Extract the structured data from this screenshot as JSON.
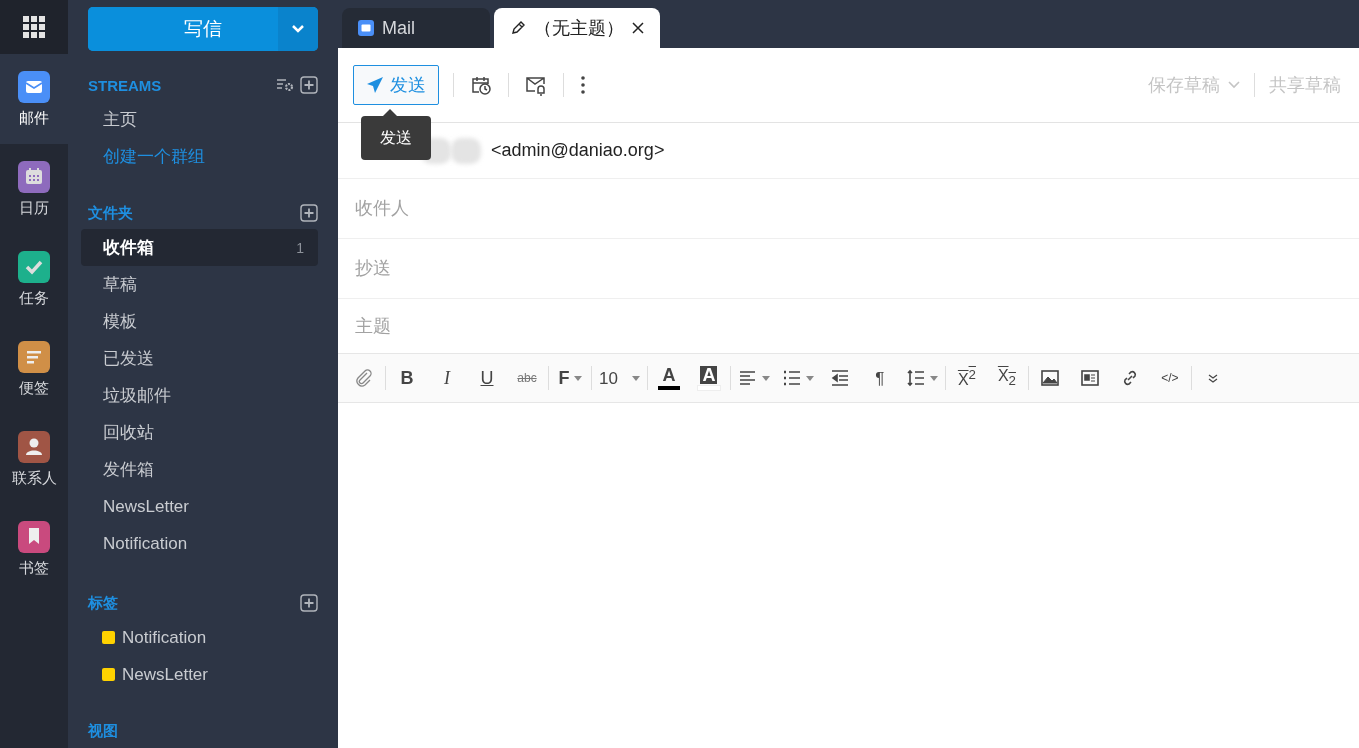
{
  "app_rail": {
    "items": [
      {
        "kind": "mail",
        "label": "邮件",
        "color": "#4a8ff7",
        "selected": true
      },
      {
        "kind": "calendar",
        "label": "日历",
        "color": "#8e6bbd",
        "selected": false
      },
      {
        "kind": "tasks",
        "label": "任务",
        "color": "#1db08c",
        "selected": false
      },
      {
        "kind": "notes",
        "label": "便签",
        "color": "#d08f47",
        "selected": false
      },
      {
        "kind": "contacts",
        "label": "联系人",
        "color": "#a05545",
        "selected": false
      },
      {
        "kind": "bookmarks",
        "label": "书签",
        "color": "#c94a7e",
        "selected": false
      }
    ]
  },
  "compose_button": {
    "label": "写信"
  },
  "streams": {
    "title": "STREAMS",
    "items": [
      {
        "label": "主页",
        "kind": "plain"
      },
      {
        "label": "创建一个群组",
        "kind": "link"
      }
    ]
  },
  "folders": {
    "title": "文件夹",
    "items": [
      {
        "label": "收件箱",
        "selected": true,
        "count": "1"
      },
      {
        "label": "草稿",
        "selected": false
      },
      {
        "label": "模板",
        "selected": false
      },
      {
        "label": "已发送",
        "selected": false
      },
      {
        "label": "垃圾邮件",
        "selected": false
      },
      {
        "label": "回收站",
        "selected": false
      },
      {
        "label": "发件箱",
        "selected": false
      },
      {
        "label": "NewsLetter",
        "selected": false
      },
      {
        "label": "Notification",
        "selected": false
      }
    ]
  },
  "tags": {
    "title": "标签",
    "items": [
      {
        "label": "Notification",
        "color": "#ffd200"
      },
      {
        "label": "NewsLetter",
        "color": "#ffd200"
      }
    ]
  },
  "views": {
    "title": "视图"
  },
  "tabs": [
    {
      "kind": "mail",
      "label": "Mail",
      "selected": false
    },
    {
      "kind": "draft",
      "label": "（无主题）",
      "selected": true
    }
  ],
  "compose_toolbar": {
    "send": "发送",
    "tooltip": "发送",
    "save_draft": "保存草稿",
    "share_draft": "共享草稿"
  },
  "fields": {
    "from": "<admin@daniao.org>",
    "to": {
      "placeholder": "收件人"
    },
    "cc": {
      "placeholder": "抄送"
    },
    "subject": {
      "placeholder": "主题"
    }
  },
  "editor_toolbar": {
    "groups": [
      [
        {
          "kind": "attach"
        }
      ],
      [
        {
          "kind": "bold",
          "text": "B"
        },
        {
          "kind": "italic",
          "text": "I"
        },
        {
          "kind": "underline",
          "text": "U"
        },
        {
          "kind": "strike",
          "text": "abc"
        }
      ],
      [
        {
          "kind": "font",
          "text": "F"
        }
      ],
      [
        {
          "kind": "size",
          "text": "10"
        }
      ],
      [
        {
          "kind": "text-color",
          "text": "A",
          "color": "#000000"
        },
        {
          "kind": "highlight",
          "text": "A",
          "color": "#ffffff"
        }
      ],
      [
        {
          "kind": "align"
        },
        {
          "kind": "list"
        },
        {
          "kind": "outdent"
        },
        {
          "kind": "paragraph",
          "text": "¶"
        },
        {
          "kind": "line-height"
        }
      ],
      [
        {
          "kind": "superscript",
          "text": "X$^{2}$"
        },
        {
          "kind": "subscript",
          "text": "X$_{2}$"
        }
      ],
      [
        {
          "kind": "image"
        },
        {
          "kind": "embed"
        },
        {
          "kind": "link"
        },
        {
          "kind": "code",
          "text": "</>"
        }
      ],
      [
        {
          "kind": "more"
        }
      ]
    ]
  }
}
